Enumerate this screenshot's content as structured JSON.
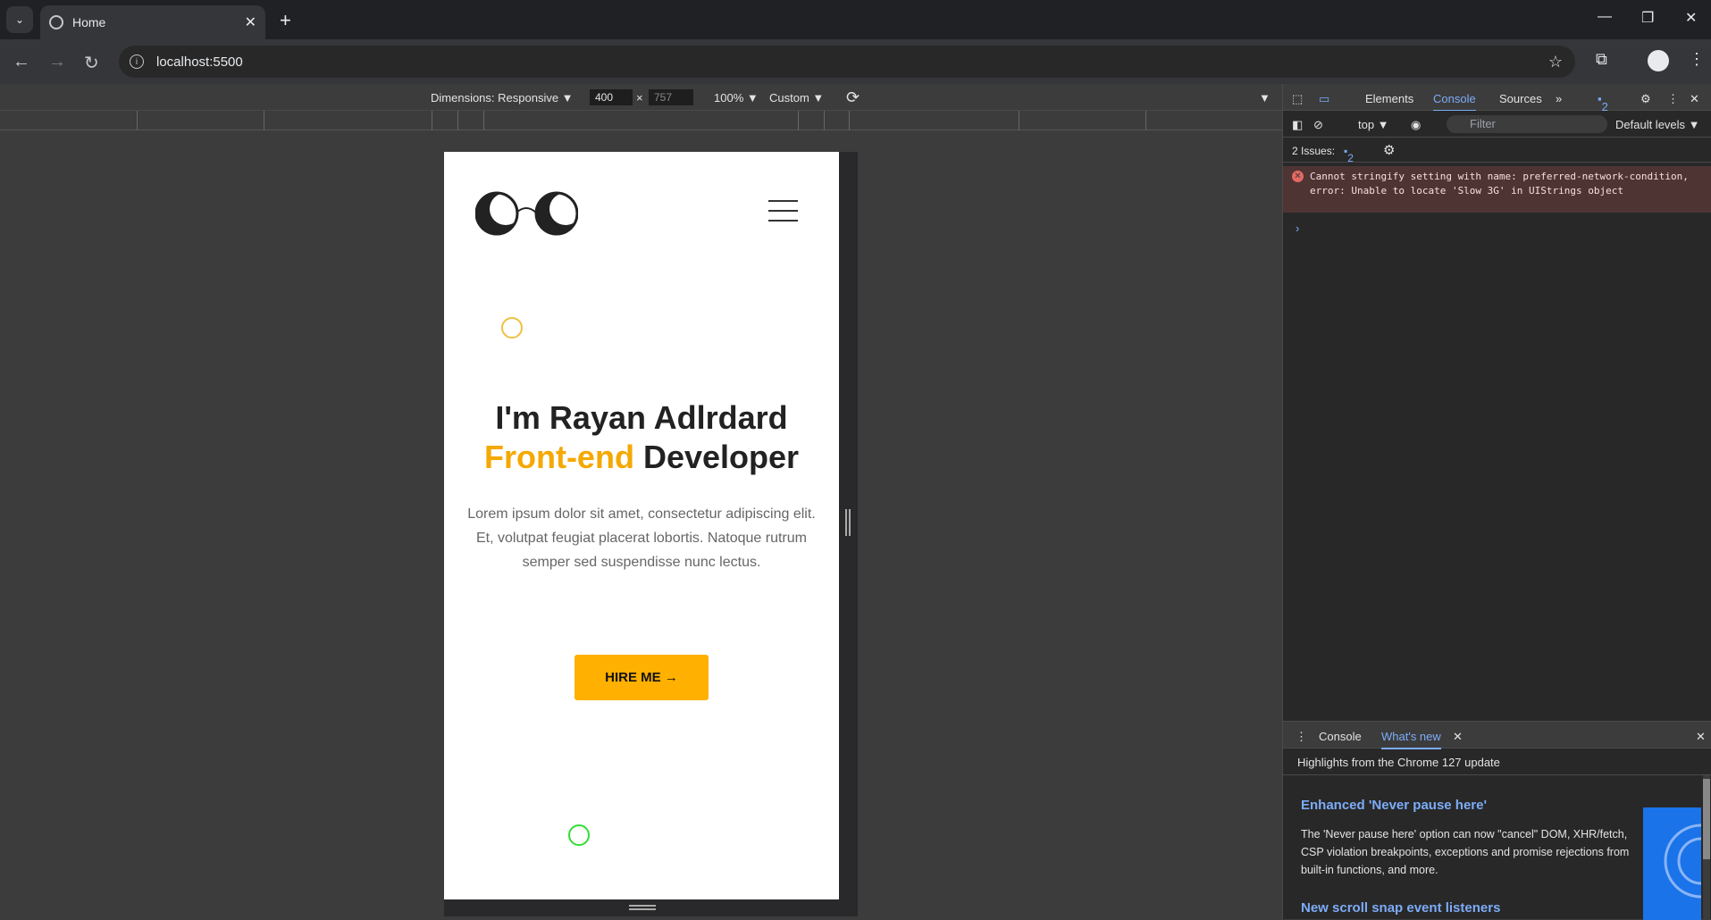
{
  "browser": {
    "tab_title": "Home",
    "new_tab": "+",
    "tab_close": "✕",
    "url": "localhost:5500"
  },
  "device_toolbar": {
    "dimensions_label": "Dimensions: Responsive ▼",
    "width": "400",
    "times": "×",
    "height": "757",
    "zoom": "100% ▼",
    "throttle": "Custom ▼",
    "more": "▼"
  },
  "page": {
    "hero_line1": "I'm Rayan Adlrdard",
    "hero_accent": "Front-end",
    "hero_rest": " Developer",
    "description": "Lorem ipsum dolor sit amet, consectetur adipiscing elit. Et, volutpat feugiat placerat lobortis. Natoque rutrum semper sed suspendisse nunc lectus.",
    "cta": "HIRE ME →",
    "colors": {
      "accent": "#f5a800",
      "button": "#ffb000",
      "circle_yellow": "#f0c040",
      "circle_green": "#33dd33"
    }
  },
  "devtools": {
    "tabs": [
      "Elements",
      "Console",
      "Sources"
    ],
    "active_tab": "Console",
    "more_tabs": "»",
    "issue_badge": "2",
    "context": "top ▼",
    "filter_placeholder": "Filter",
    "levels": "Default levels ▼",
    "issues_label": "2 Issues:",
    "issues_count": "2",
    "error_message": "Cannot stringify setting with name: preferred-network-condition, error: Unable to locate 'Slow 3G' in UIStrings object",
    "prompt": "›"
  },
  "drawer": {
    "tabs": [
      "Console",
      "What's new"
    ],
    "active_tab": "What's new",
    "heading": "Highlights from the Chrome 127 update",
    "item1_title": "Enhanced 'Never pause here'",
    "item1_body": "The 'Never pause here' option can now \"cancel\" DOM, XHR/fetch, CSP violation breakpoints, exceptions and promise rejections from built-in functions, and more.",
    "item2_title": "New scroll snap event listeners"
  }
}
